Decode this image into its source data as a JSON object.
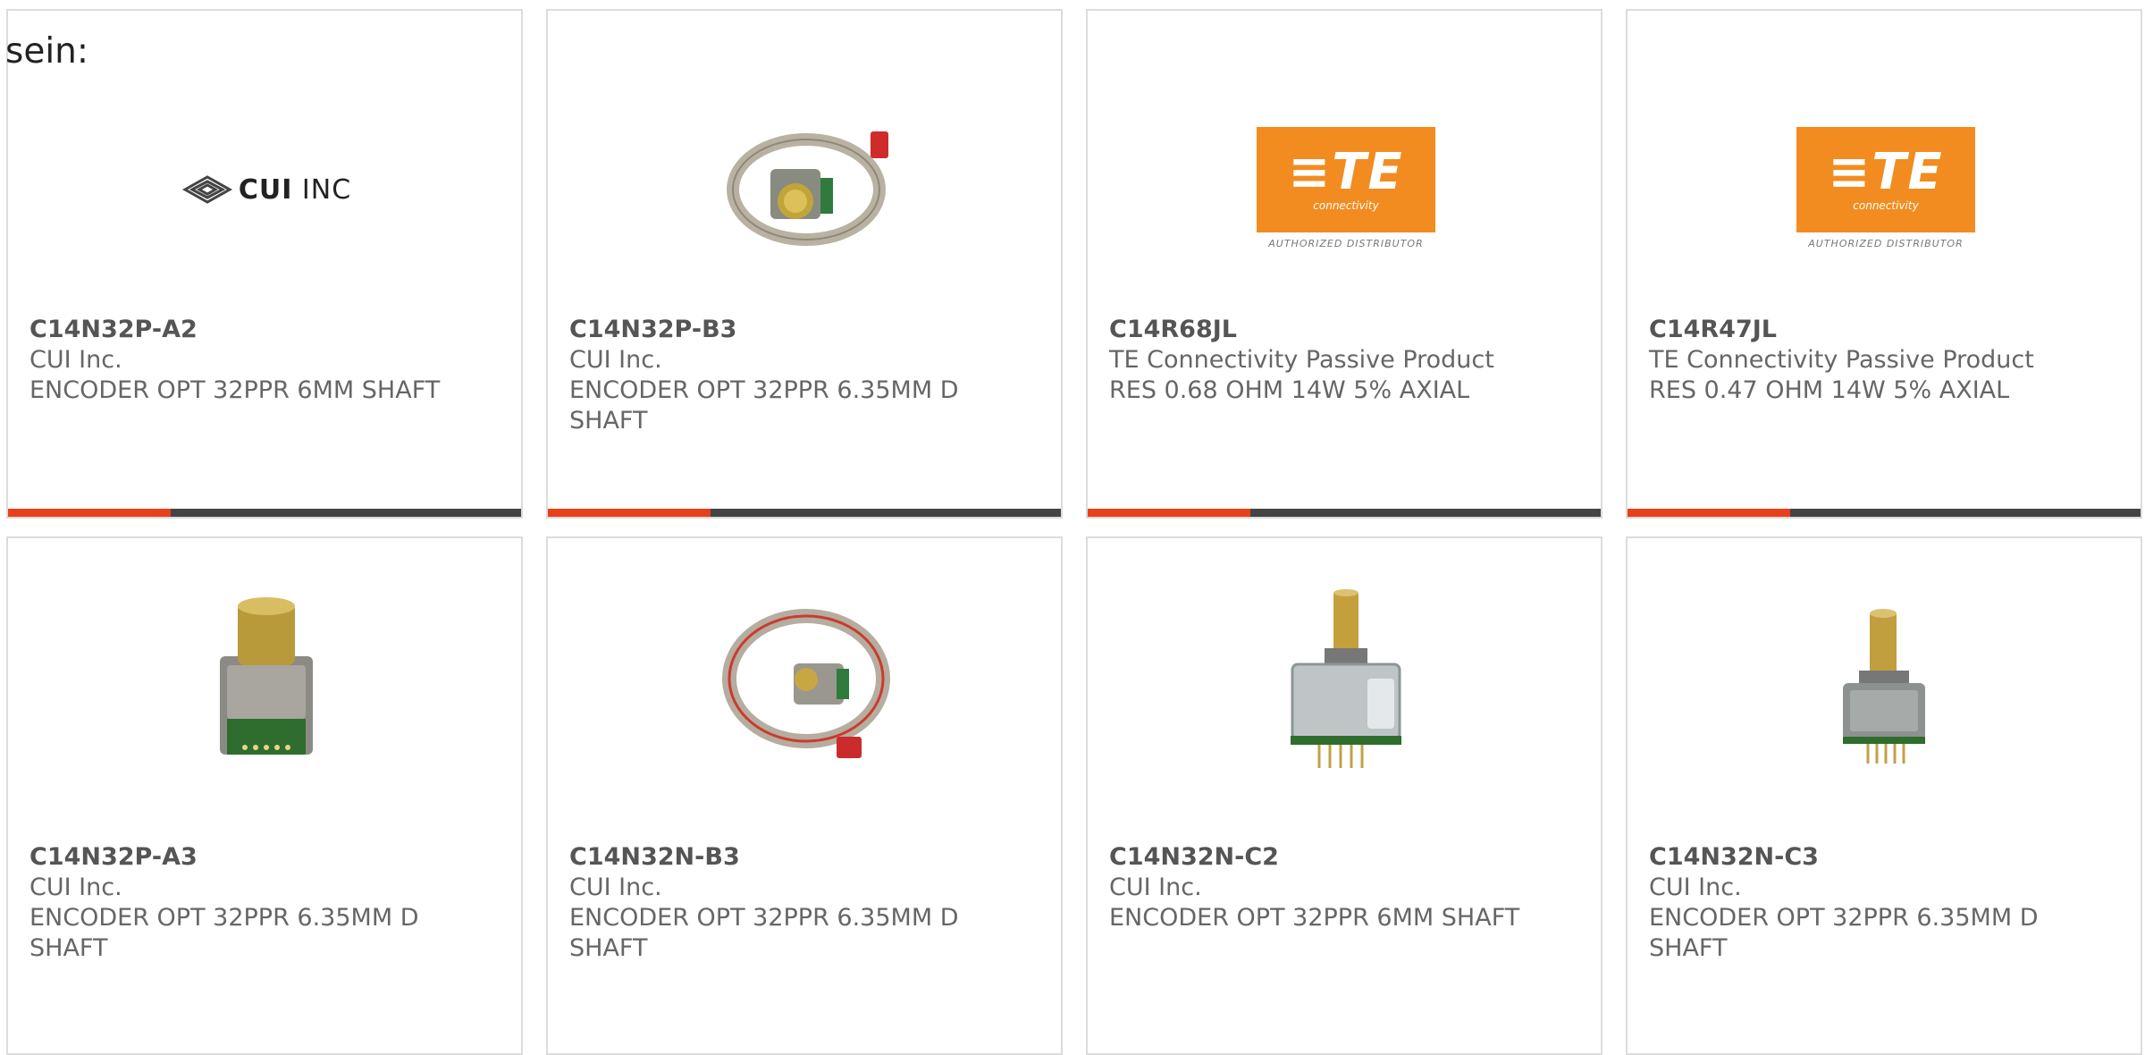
{
  "intro_text": "sein:",
  "products": [
    {
      "part": "C14N32P-A2",
      "manufacturer": "CUI Inc.",
      "description": "ENCODER OPT 32PPR 6MM SHAFT",
      "image": "cui-logo",
      "logo_text_bold": "CUI",
      "logo_text": " INC"
    },
    {
      "part": "C14N32P-B3",
      "manufacturer": "CUI Inc.",
      "description": "ENCODER OPT 32PPR 6.35MM D SHAFT",
      "image": "encoder-with-ribbon-cable-photo"
    },
    {
      "part": "C14R68JL",
      "manufacturer": "TE Connectivity Passive Product",
      "description": "RES 0.68 OHM 14W 5% AXIAL",
      "image": "te-logo",
      "logo_mark": "≡TE",
      "logo_sub": "connectivity",
      "logo_dist": "AUTHORIZED DISTRIBUTOR"
    },
    {
      "part": "C14R47JL",
      "manufacturer": "TE Connectivity Passive Product",
      "description": "RES 0.47 OHM 14W 5% AXIAL",
      "image": "te-logo",
      "logo_mark": "≡TE",
      "logo_sub": "connectivity",
      "logo_dist": "AUTHORIZED DISTRIBUTOR"
    },
    {
      "part": "C14N32P-A3",
      "manufacturer": "CUI Inc.",
      "description": "ENCODER OPT 32PPR 6.35MM D SHAFT",
      "image": "encoder-pcb-photo"
    },
    {
      "part": "C14N32N-B3",
      "manufacturer": "CUI Inc.",
      "description": "ENCODER OPT 32PPR 6.35MM D SHAFT",
      "image": "encoder-with-red-ribbon-cable-photo"
    },
    {
      "part": "C14N32N-C2",
      "manufacturer": "CUI Inc.",
      "description": "ENCODER OPT 32PPR 6MM SHAFT",
      "image": "encoder-with-pins-photo"
    },
    {
      "part": "C14N32N-C3",
      "manufacturer": "CUI Inc.",
      "description": "ENCODER OPT 32PPR 6.35MM D SHAFT",
      "image": "encoder-small-photo"
    }
  ],
  "colors": {
    "accent": "#e8411a",
    "bar": "#444444",
    "te_orange": "#f28c20",
    "text": "#666666"
  }
}
